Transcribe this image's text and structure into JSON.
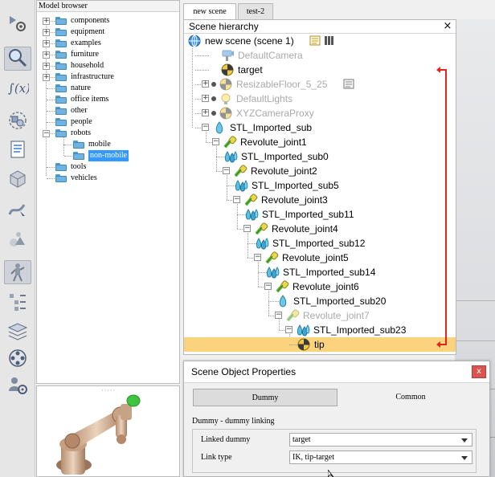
{
  "toolbar": {
    "buttons": [
      {
        "icon": "simulation-settings-icon"
      },
      {
        "icon": "zoom-icon"
      },
      {
        "icon": "calculation-module-icon"
      },
      {
        "icon": "collections-icon"
      },
      {
        "icon": "script-icon"
      },
      {
        "icon": "shape-edit-icon"
      },
      {
        "icon": "path-edit-icon"
      },
      {
        "icon": "primitive-shapes-icon"
      },
      {
        "icon": "model-browser-icon"
      },
      {
        "icon": "scene-hierarchy-icon"
      },
      {
        "icon": "layers-icon"
      },
      {
        "icon": "video-recorder-icon"
      },
      {
        "icon": "user-settings-icon"
      }
    ]
  },
  "model_browser": {
    "title": "Model browser",
    "items": [
      {
        "label": "components",
        "expandable": true
      },
      {
        "label": "equipment",
        "expandable": true
      },
      {
        "label": "examples",
        "expandable": true
      },
      {
        "label": "furniture",
        "expandable": true
      },
      {
        "label": "household",
        "expandable": true
      },
      {
        "label": "infrastructure",
        "expandable": true
      },
      {
        "label": "nature",
        "expandable": false
      },
      {
        "label": "office items",
        "expandable": false
      },
      {
        "label": "other",
        "expandable": false
      },
      {
        "label": "people",
        "expandable": false
      },
      {
        "label": "robots",
        "expandable": true,
        "expanded": true
      },
      {
        "label": "mobile",
        "child": true
      },
      {
        "label": "non-mobile",
        "child": true,
        "selected": true
      },
      {
        "label": "tools",
        "expandable": false
      },
      {
        "label": "vehicles",
        "expandable": false
      }
    ]
  },
  "tabs": [
    {
      "label": "new scene",
      "active": true
    },
    {
      "label": "test-2",
      "active": false
    }
  ],
  "hierarchy": {
    "title": "Scene hierarchy",
    "close": "×",
    "items": [
      {
        "label": "new scene (scene 1)",
        "level": 0,
        "icon": "world-icon",
        "grey": false
      },
      {
        "label": "DefaultCamera",
        "level": 1,
        "icon": "camera-icon",
        "grey": true
      },
      {
        "label": "target",
        "level": 1,
        "icon": "dummy-icon",
        "grey": false
      },
      {
        "label": "ResizableFloor_5_25",
        "level": 1,
        "icon": "dummy-icon",
        "grey": true,
        "expandable": true
      },
      {
        "label": "DefaultLights",
        "level": 1,
        "icon": "light-icon",
        "grey": true,
        "expandable": true
      },
      {
        "label": "XYZCameraProxy",
        "level": 1,
        "icon": "dummy-icon",
        "grey": true,
        "expandable": true
      },
      {
        "label": "STL_Imported_sub",
        "level": 1,
        "icon": "shape-icon",
        "grey": false,
        "expandable": true
      },
      {
        "label": "Revolute_joint1",
        "level": 2,
        "icon": "joint-icon",
        "grey": false,
        "expandable": true
      },
      {
        "label": "STL_Imported_sub0",
        "level": 3,
        "icon": "multishape-icon",
        "grey": false
      },
      {
        "label": "Revolute_joint2",
        "level": 3,
        "icon": "joint-icon",
        "grey": false,
        "expandable": true
      },
      {
        "label": "STL_Imported_sub5",
        "level": 4,
        "icon": "multishape-icon",
        "grey": false
      },
      {
        "label": "Revolute_joint3",
        "level": 4,
        "icon": "joint-icon",
        "grey": false,
        "expandable": true
      },
      {
        "label": "STL_Imported_sub11",
        "level": 5,
        "icon": "multishape-icon",
        "grey": false
      },
      {
        "label": "Revolute_joint4",
        "level": 5,
        "icon": "joint-icon",
        "grey": false,
        "expandable": true
      },
      {
        "label": "STL_Imported_sub12",
        "level": 6,
        "icon": "multishape-icon",
        "grey": false
      },
      {
        "label": "Revolute_joint5",
        "level": 6,
        "icon": "joint-icon",
        "grey": false,
        "expandable": true
      },
      {
        "label": "STL_Imported_sub14",
        "level": 7,
        "icon": "multishape-icon",
        "grey": false
      },
      {
        "label": "Revolute_joint6",
        "level": 7,
        "icon": "joint-icon",
        "grey": false,
        "expandable": true
      },
      {
        "label": "STL_Imported_sub20",
        "level": 8,
        "icon": "shape-icon",
        "grey": false
      },
      {
        "label": "Revolute_joint7",
        "level": 8,
        "icon": "joint-icon",
        "grey": true,
        "expandable": true
      },
      {
        "label": "STL_Imported_sub23",
        "level": 9,
        "icon": "multishape-icon",
        "grey": false,
        "expandable": true
      },
      {
        "label": "tip",
        "level": 10,
        "icon": "dummy-icon",
        "grey": false,
        "selected": true
      }
    ]
  },
  "properties": {
    "title": "Scene Object Properties",
    "close": "x",
    "tabs": [
      "Dummy",
      "Common"
    ],
    "section": "Dummy - dummy linking",
    "fields": {
      "linked_dummy_label": "Linked dummy",
      "linked_dummy_value": "target",
      "link_type_label": "Link type",
      "link_type_value": "IK, tip-target"
    }
  },
  "colors": {
    "selection": "#fbd27e",
    "link_arrow": "#e0271f",
    "tree_selection": "#3399ff"
  }
}
